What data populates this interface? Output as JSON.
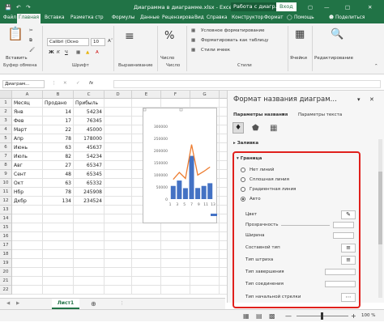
{
  "window": {
    "title": "Диаграмма в диаграмме.xlsx - Excel",
    "context": "Работа с диагр...",
    "login": "Вход"
  },
  "tabs": [
    "Файл",
    "Главная",
    "Вставка",
    "Разметка стр",
    "Формулы",
    "Данные",
    "Рецензирова",
    "Вид",
    "Справка",
    "Конструктор",
    "Формат",
    "Помощь",
    "Поделиться"
  ],
  "ribbon": {
    "paste": "Вставить",
    "font_name": "Calibri (Осно",
    "font_size": "10",
    "align": "Выравнивание",
    "number_label": "Число",
    "cond_format": "Условное форматирование",
    "table_format": "Форматировать как таблицу",
    "cell_styles": "Стили ячеек",
    "cells": "Ячейки",
    "editing": "Редактирование",
    "groups": {
      "clipboard": "Буфер обмена",
      "font": "Шрифт",
      "align": "Выравнивание",
      "number": "Число",
      "styles": "Стили"
    }
  },
  "formula_bar": {
    "name_box": "Диаграм..."
  },
  "columns": [
    "A",
    "B",
    "C",
    "D",
    "E",
    "F",
    "G",
    "H"
  ],
  "rows": [
    "1",
    "2",
    "3",
    "4",
    "5",
    "6",
    "7",
    "8",
    "9",
    "10",
    "11",
    "12",
    "13",
    "14",
    "15",
    "16",
    "17",
    "18",
    "19",
    "20",
    "21",
    "22"
  ],
  "table": {
    "headers": [
      "Месяц",
      "Продано",
      "Прибыль"
    ],
    "data": [
      [
        "Янв",
        "14",
        "54234"
      ],
      [
        "Фев",
        "17",
        "76345"
      ],
      [
        "Март",
        "22",
        "45000"
      ],
      [
        "Апр",
        "78",
        "178000"
      ],
      [
        "Июнь",
        "63",
        "45637"
      ],
      [
        "Июль",
        "82",
        "54234"
      ],
      [
        "Авг",
        "27",
        "65347"
      ],
      [
        "Сент",
        "48",
        "65345"
      ],
      [
        "Окт",
        "63",
        "65332"
      ],
      [
        "Нбр",
        "78",
        "245908"
      ],
      [
        "Дкбр",
        "134",
        "234524"
      ]
    ]
  },
  "chart_data": {
    "type": "bar",
    "categories": [
      "1",
      "3",
      "5",
      "7",
      "9",
      "11",
      "13"
    ],
    "y_ticks": [
      "300000",
      "250000",
      "200000",
      "150000",
      "100000",
      "50000",
      "0"
    ],
    "ylim": [
      0,
      300000
    ],
    "series": [
      {
        "values": [
          54234,
          76345,
          45000,
          178000,
          45637,
          54234,
          65347
        ]
      }
    ]
  },
  "panel": {
    "title": "Формат названия диаграм...",
    "tab_title": "Параметры названия",
    "tab_text": "Параметры текста",
    "fill": "Заливка",
    "border": "Граница",
    "options": [
      "Нет линий",
      "Сплошная линия",
      "Градиентная линия",
      "Авто"
    ],
    "selected": "Авто",
    "props": [
      "Цвет",
      "Прозрачность",
      "Ширина",
      "Составной тип",
      "Тип штриха",
      "Тип завершения",
      "Тип соединения",
      "Тип начальной стрелки"
    ],
    "values": [
      "",
      "",
      ""
    ]
  },
  "sheet": {
    "tab": "Лист1"
  },
  "status": {
    "zoom": "100 %",
    "ready": ""
  },
  "colors": {
    "accent": "#217346",
    "bar": "#4472c4",
    "line": "#ed7d31",
    "highlight": "#e0201c"
  }
}
